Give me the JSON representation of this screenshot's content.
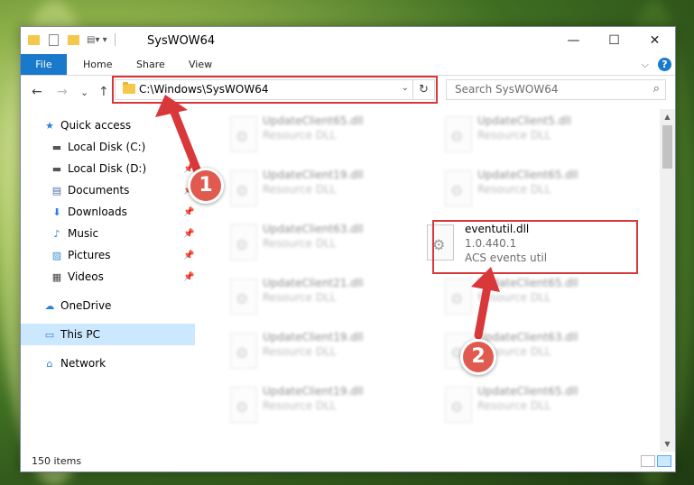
{
  "window": {
    "title": "SysWOW64",
    "minimize": "—",
    "maximize": "☐",
    "close": "✕"
  },
  "ribbon": {
    "tabs": [
      "File",
      "Home",
      "Share",
      "View"
    ],
    "help": "?",
    "expand": "⌵"
  },
  "navigation": {
    "back": "←",
    "forward": "→",
    "recent": "⌄",
    "up": "↑",
    "address": "C:\\Windows\\SysWOW64",
    "address_dropdown": "⌄",
    "refresh": "↻",
    "search_placeholder": "Search SysWOW64",
    "search_icon": "⌕"
  },
  "sidebar": {
    "items": [
      {
        "label": "Quick access",
        "icon": "star-icon",
        "glyph": "★"
      },
      {
        "label": "Local Disk (C:)",
        "icon": "drive-icon",
        "glyph": "▬"
      },
      {
        "label": "Local Disk (D:)",
        "icon": "drive-icon",
        "glyph": "▬",
        "pin": "📌"
      },
      {
        "label": "Documents",
        "icon": "documents-icon",
        "glyph": "▤",
        "pin": "📌"
      },
      {
        "label": "Downloads",
        "icon": "download-icon",
        "glyph": "⬇",
        "pin": "📌"
      },
      {
        "label": "Music",
        "icon": "music-icon",
        "glyph": "♪",
        "pin": "📌"
      },
      {
        "label": "Pictures",
        "icon": "pictures-icon",
        "glyph": "▨",
        "pin": "📌"
      },
      {
        "label": "Videos",
        "icon": "videos-icon",
        "glyph": "▦",
        "pin": "📌"
      },
      {
        "label": "OneDrive",
        "icon": "cloud-icon",
        "glyph": "☁"
      },
      {
        "label": "This PC",
        "icon": "computer-icon",
        "glyph": "▭"
      },
      {
        "label": "Network",
        "icon": "network-icon",
        "glyph": "⌂"
      }
    ]
  },
  "files": [
    {
      "name": "UpdateClient65.dll",
      "desc": "Resource DLL"
    },
    {
      "name": "UpdateClient5.dll",
      "desc": "Resource DLL"
    },
    {
      "name": "UpdateClient19.dll",
      "desc": "Resource DLL"
    },
    {
      "name": "UpdateClient65.dll",
      "desc": "Resource DLL"
    },
    {
      "name": "UpdateClient63.dll",
      "desc": "Resource DLL"
    },
    {
      "name": "eventutil.dll",
      "version": "1.0.440.1",
      "desc": "ACS events util"
    },
    {
      "name": "UpdateClient21.dll",
      "desc": "Resource DLL"
    },
    {
      "name": "UpdateClient65.dll",
      "desc": "Resource DLL"
    },
    {
      "name": "UpdateClient19.dll",
      "desc": "Resource DLL"
    },
    {
      "name": "UpdateClient63.dll",
      "desc": "Resource DLL"
    },
    {
      "name": "UpdateClient19.dll",
      "desc": "Resource DLL"
    },
    {
      "name": "UpdateClient65.dll",
      "desc": "Resource DLL"
    }
  ],
  "status": {
    "item_count": "150 items"
  },
  "annotations": {
    "step1": "1",
    "step2": "2",
    "highlight_color": "#d9383a",
    "callout_color": "#e15a4f"
  }
}
